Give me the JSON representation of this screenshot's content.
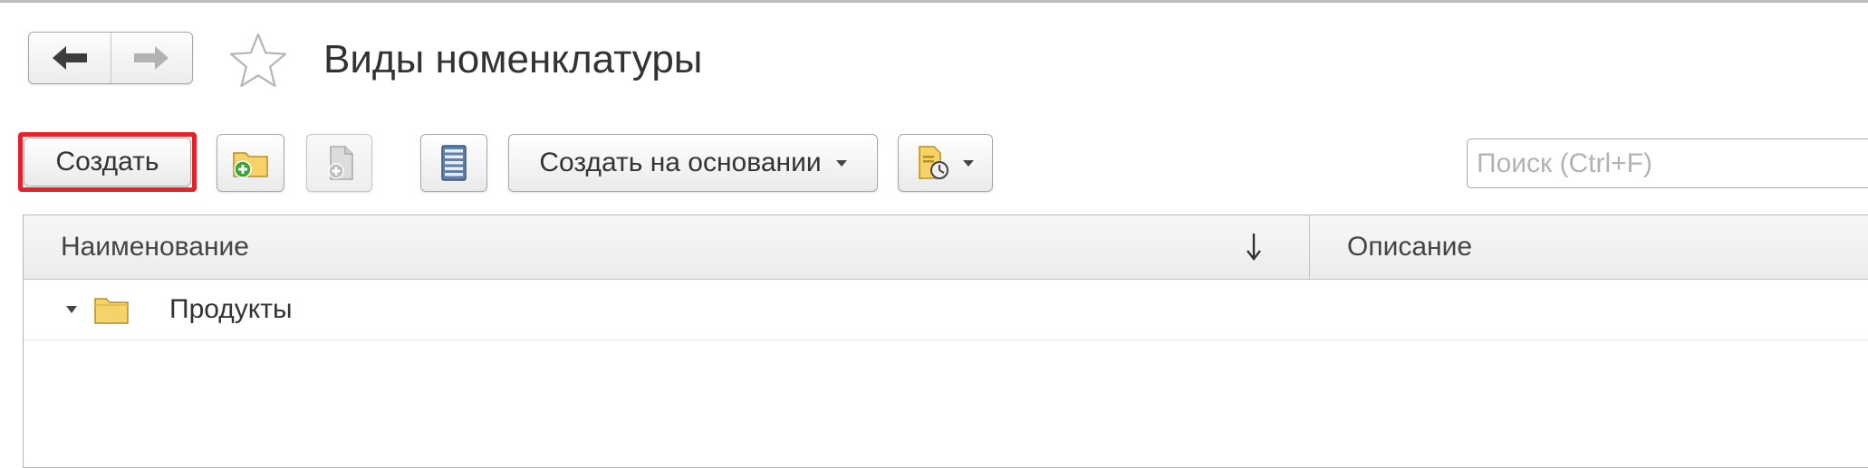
{
  "header": {
    "title": "Виды номенклатуры"
  },
  "toolbar": {
    "create_label": "Создать",
    "create_based_on_label": "Создать на основании",
    "search_placeholder": "Поиск (Ctrl+F)",
    "search_value": ""
  },
  "table": {
    "columns": [
      {
        "label": "Наименование",
        "sorted": "descending"
      },
      {
        "label": "Описание"
      }
    ],
    "rows": [
      {
        "name": "Продукты",
        "type": "group",
        "expanded": true,
        "description": ""
      }
    ]
  },
  "colors": {
    "highlight": "#e8202a",
    "folder": "#f5d36a",
    "add_badge": "#3aa535"
  },
  "icons": {
    "back": "arrow-left-icon",
    "forward": "arrow-right-icon",
    "favorite": "star-icon",
    "create_group": "folder-add-icon",
    "copy": "document-copy-icon",
    "list_view": "list-icon",
    "reports": "report-menu-icon",
    "sort": "sort-down-icon",
    "group_row": "folder-icon"
  }
}
